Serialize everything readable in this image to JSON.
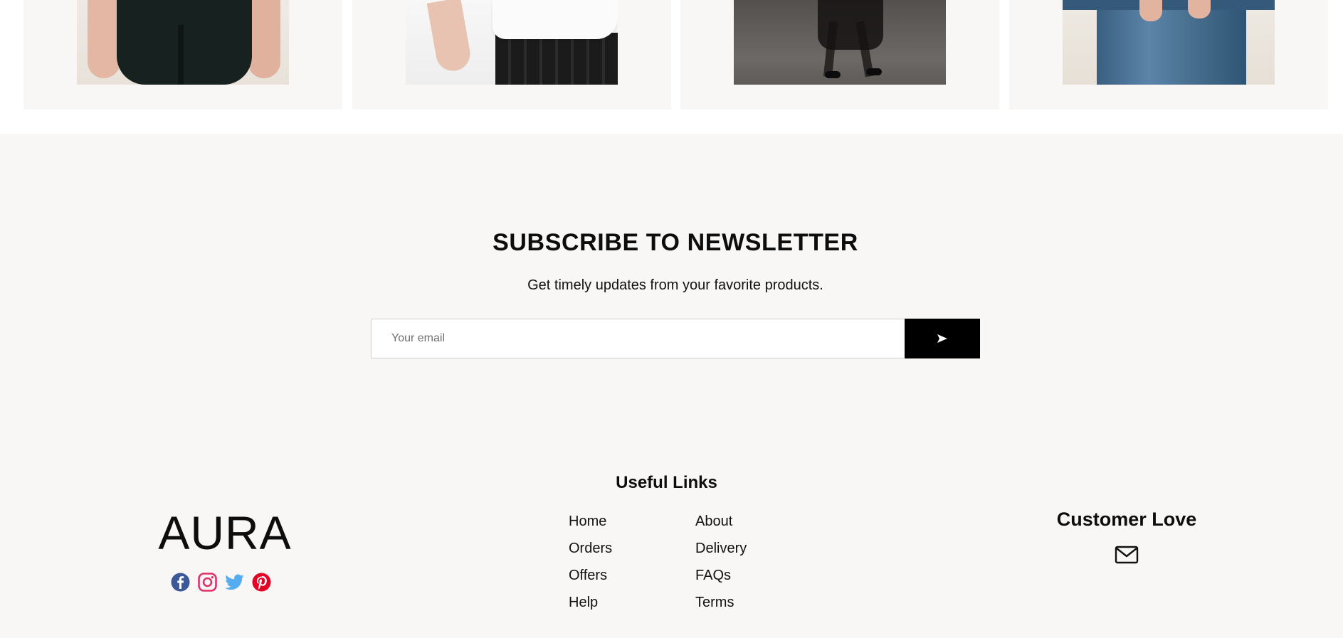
{
  "products": [
    {
      "name": "product-card-shorts",
      "alt": "Black bike shorts"
    },
    {
      "name": "product-card-skirt",
      "alt": "White top with black pleated skirt"
    },
    {
      "name": "product-card-dress",
      "alt": "Sheer black dress with heels"
    },
    {
      "name": "product-card-jeans",
      "alt": "Blue denim jeans"
    }
  ],
  "newsletter": {
    "title": "SUBSCRIBE TO NEWSLETTER",
    "subtitle": "Get timely updates from your favorite products.",
    "email_placeholder": "Your email",
    "submit_icon": "send-icon"
  },
  "footer": {
    "brand": "AURA",
    "social": [
      {
        "icon": "facebook-icon",
        "color": "#3b5998"
      },
      {
        "icon": "instagram-icon",
        "color": "#e1306c"
      },
      {
        "icon": "twitter-icon",
        "color": "#1da1f2"
      },
      {
        "icon": "pinterest-icon",
        "color": "#e60023"
      }
    ],
    "useful_links": {
      "title": "Useful Links",
      "items": [
        "Home",
        "About",
        "Orders",
        "Delivery",
        "Offers",
        "FAQs",
        "Help",
        "Terms"
      ]
    },
    "customer_love": {
      "title": "Customer Love",
      "icon": "mail-icon"
    }
  }
}
